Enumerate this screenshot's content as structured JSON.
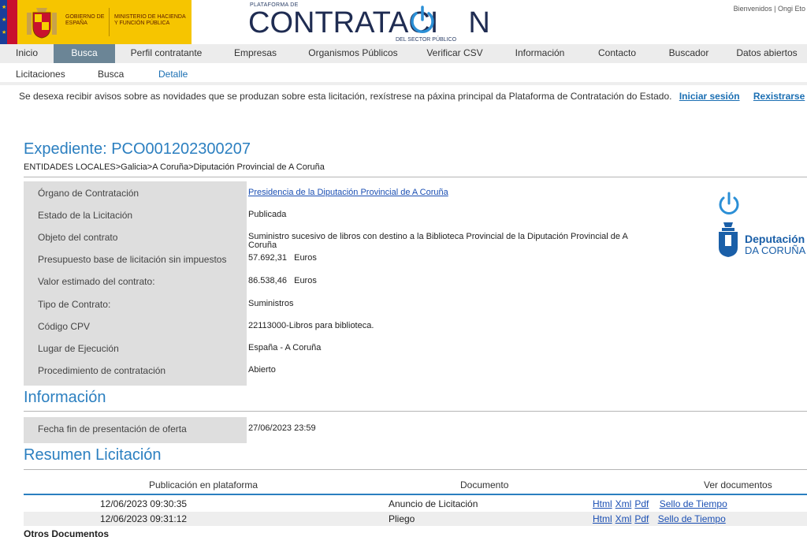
{
  "header": {
    "gov_line1": "GOBIERNO DE ESPAÑA",
    "gov_line2": "MINISTERIO DE HACIENDA Y FUNCIÓN PÚBLICA",
    "logo_small": "PLATAFORMA DE",
    "logo_main": "CONTRATACI",
    "logo_main_end": "N",
    "logo_sub": "DEL SECTOR PÚBLICO",
    "welcome": "Bienvenidos | Ongi Eto"
  },
  "mainnav": [
    {
      "label": "Inicio",
      "active": false
    },
    {
      "label": "Busca",
      "active": true
    },
    {
      "label": "Perfil contratante",
      "active": false
    },
    {
      "label": "Empresas",
      "active": false
    },
    {
      "label": "Organismos Públicos",
      "active": false
    },
    {
      "label": "Verificar CSV",
      "active": false
    },
    {
      "label": "Información",
      "active": false
    },
    {
      "label": "Contacto",
      "active": false
    },
    {
      "label": "Buscador",
      "active": false
    },
    {
      "label": "Datos abiertos",
      "active": false
    }
  ],
  "subnav": [
    {
      "label": "Licitaciones"
    },
    {
      "label": "Busca"
    },
    {
      "label": "Detalle"
    }
  ],
  "notice": {
    "text": "Se desexa recibir avisos sobre as novidades que se produzan sobre esta licitación, rexístrese na páxina principal da Plataforma de Contratación do Estado.",
    "login": "Iniciar sesión",
    "register": "Rexistrarse"
  },
  "expediente": {
    "title": "Expediente:  PCO001202300207",
    "breadcrumb": "ENTIDADES LOCALES>Galicia>A Coruña>Diputación Provincial de A Coruña"
  },
  "details": [
    {
      "label": "Órgano de Contratación",
      "value": "Presidencia de la Diputación Provincial de A Coruña",
      "link": true
    },
    {
      "label": "Estado de la Licitación",
      "value": "Publicada"
    },
    {
      "label": "Objeto del contrato",
      "value": "Suministro sucesivo de libros con destino a la Biblioteca Provincial de la Diputación Provincial de A Coruña"
    },
    {
      "label": "Presupuesto base de licitación sin impuestos",
      "value": "57.692,31   Euros"
    },
    {
      "label": "Valor estimado del contrato:",
      "value": "86.538,46   Euros"
    },
    {
      "label": "Tipo de Contrato:",
      "value": "Suministros"
    },
    {
      "label": "Código CPV",
      "value": "22113000-Libros para biblioteca."
    },
    {
      "label": "Lugar de Ejecución",
      "value": "España - A Coruña"
    },
    {
      "label": "Procedimiento de contratación",
      "value": "Abierto"
    }
  ],
  "dip_logo": {
    "line1": "Deputación",
    "line2": "DA CORUÑA"
  },
  "informacion": {
    "title": "Información",
    "label": "Fecha fin de presentación de oferta",
    "value": "27/06/2023 23:59"
  },
  "resumen": {
    "title": "Resumen Licitación",
    "headers": [
      "Publicación en plataforma",
      "Documento",
      "Ver documentos"
    ],
    "rows": [
      {
        "date": "12/06/2023 09:30:35",
        "doc": "Anuncio de Licitación",
        "links": [
          "Html",
          "Xml",
          "Pdf"
        ],
        "seal": "Sello de Tiempo"
      },
      {
        "date": "12/06/2023 09:31:12",
        "doc": "Pliego",
        "links": [
          "Html",
          "Xml",
          "Pdf"
        ],
        "seal": "Sello de Tiempo"
      }
    ]
  },
  "otros": "Otros Documentos"
}
